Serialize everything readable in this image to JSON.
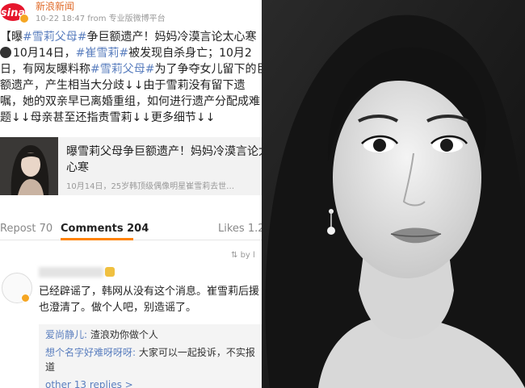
{
  "post": {
    "logo_text": "sina",
    "account": "新浪新闻",
    "meta": "10-22 18:47  from 专业版微博平台",
    "body_lines": [
      [
        "【曝",
        "#雪莉父母#",
        "争巨额遗产！妈妈冷漠言论太心寒"
      ],
      [
        "10月14日，",
        "#崔雪莉#",
        "被发现自杀身亡；10月2"
      ],
      [
        "日，有网友曝料称",
        "#雪莉父母#",
        "为了争夺女儿留下的巨"
      ],
      [
        "额遗产，产生相当大分歧↓↓由于雪莉没有留下遗"
      ],
      [
        "嘱，她的双亲早已离婚重组，如何进行遗产分配成难"
      ],
      [
        "题↓↓母亲甚至还指责雪莉↓↓更多细节↓↓"
      ]
    ],
    "card_title": "曝雪莉父母争巨额遗产！妈妈冷漠言论太心寒",
    "card_sub": "10月14日，25岁韩顶级偶像明星崔雪莉去世…"
  },
  "tabs": {
    "repost": "Repost 70",
    "comments": "Comments 204",
    "likes": "Likes 1.2"
  },
  "sort_label": "by l",
  "comment": {
    "text_lines": [
      "已经辟谣了，韩网从没有这个消息。崔雪莉后援",
      "也澄清了。做个人吧，别造谣了。"
    ],
    "replies": [
      {
        "who": "爱尚静儿:",
        "text": " 渣浪劝你做个人"
      },
      {
        "who": "想个名字好难呀呀呀:",
        "text": " 大家可以一起投诉，不实报"
      }
    ],
    "reply_cont": "道",
    "more_replies": "other 13 replies >"
  },
  "colors": {
    "accent": "#ff8200",
    "link": "#5b7fbf",
    "account": "#e06b2a"
  }
}
